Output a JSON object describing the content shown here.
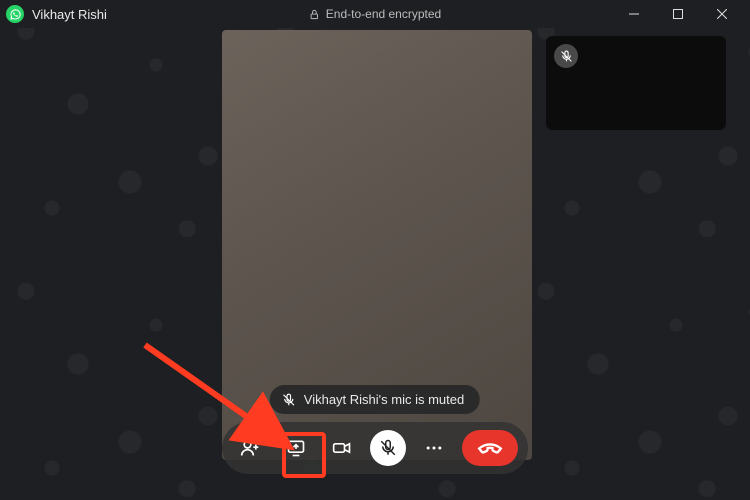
{
  "header": {
    "contact_name": "Vikhayt Rishi",
    "encryption_label": "End-to-end encrypted"
  },
  "toast": {
    "message": "Vikhayt Rishi's mic is muted"
  },
  "colors": {
    "whatsapp_green": "#25d366",
    "hangup_red": "#e7352c",
    "highlight": "#ff3b21"
  },
  "call_controls": {
    "add_participant": "add-participant",
    "screen_share": "screen-share",
    "video_toggle": "video-toggle",
    "mic_toggle": "mic-toggle",
    "more": "more-options",
    "hangup": "end-call"
  }
}
